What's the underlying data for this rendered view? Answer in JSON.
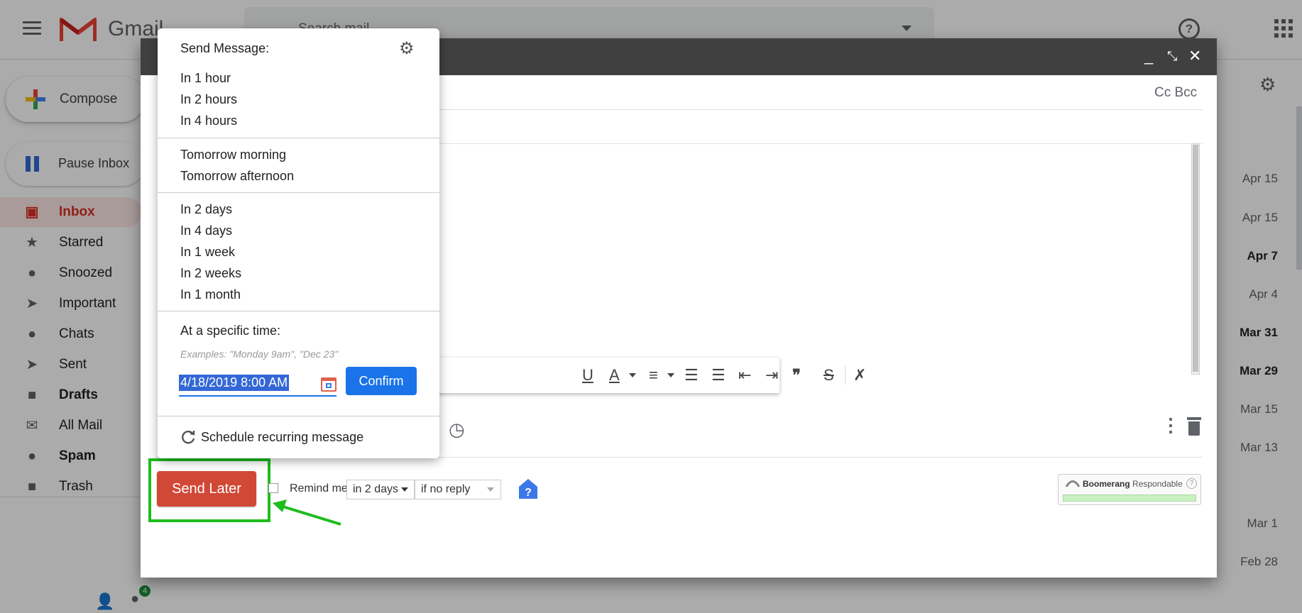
{
  "app": {
    "logo_text": "Gmail",
    "search_placeholder": "Search mail"
  },
  "sidebar": {
    "compose_label": "Compose",
    "pause_label": "Pause Inbox",
    "items": [
      {
        "label": "Inbox",
        "icon": "inbox-icon",
        "active": true
      },
      {
        "label": "Starred",
        "icon": "star-icon"
      },
      {
        "label": "Snoozed",
        "icon": "clock-icon"
      },
      {
        "label": "Important",
        "icon": "important-icon"
      },
      {
        "label": "Chats",
        "icon": "chat-icon"
      },
      {
        "label": "Sent",
        "icon": "send-icon"
      },
      {
        "label": "Drafts",
        "icon": "draft-icon",
        "bold": true
      },
      {
        "label": "All Mail",
        "icon": "mail-icon"
      },
      {
        "label": "Spam",
        "icon": "spam-icon",
        "bold": true
      },
      {
        "label": "Trash",
        "icon": "trash-icon"
      }
    ],
    "chat_badge": "4"
  },
  "mail_list": {
    "dates": [
      "Apr 15",
      "Apr 15",
      "Apr 7",
      "Apr 4",
      "Mar 31",
      "Mar 29",
      "Mar 15",
      "Mar 13",
      "Mar 1",
      "Feb 28"
    ],
    "bold": [
      false,
      false,
      true,
      false,
      true,
      true,
      false,
      false,
      false,
      false
    ]
  },
  "compose": {
    "cc_bcc": "Cc Bcc",
    "send_later_label": "Send Later",
    "remind_label": "Remind me",
    "remind_select": "in 2 days",
    "condition_select": "if no reply",
    "boomerang_brand": "Boomerang",
    "boomerang_product": "Respondable",
    "boomerang_help": "?"
  },
  "schedule_menu": {
    "title": "Send Message:",
    "groups": [
      [
        "In 1 hour",
        "In 2 hours",
        "In 4 hours"
      ],
      [
        "Tomorrow morning",
        "Tomorrow afternoon"
      ],
      [
        "In 2 days",
        "In 4 days",
        "In 1 week",
        "In 2 weeks",
        "In 1 month"
      ]
    ],
    "specific_title": "At a specific time:",
    "specific_examples": "Examples: \"Monday 9am\", \"Dec 23\"",
    "time_value": "4/18/2019 8:00 AM",
    "confirm_label": "Confirm",
    "recurring_label": "Schedule recurring message"
  },
  "colors": {
    "send_later": "#d14836",
    "highlight": "#1ebd1e",
    "confirm": "#1a73e8",
    "inbox_active": "#d93025"
  }
}
